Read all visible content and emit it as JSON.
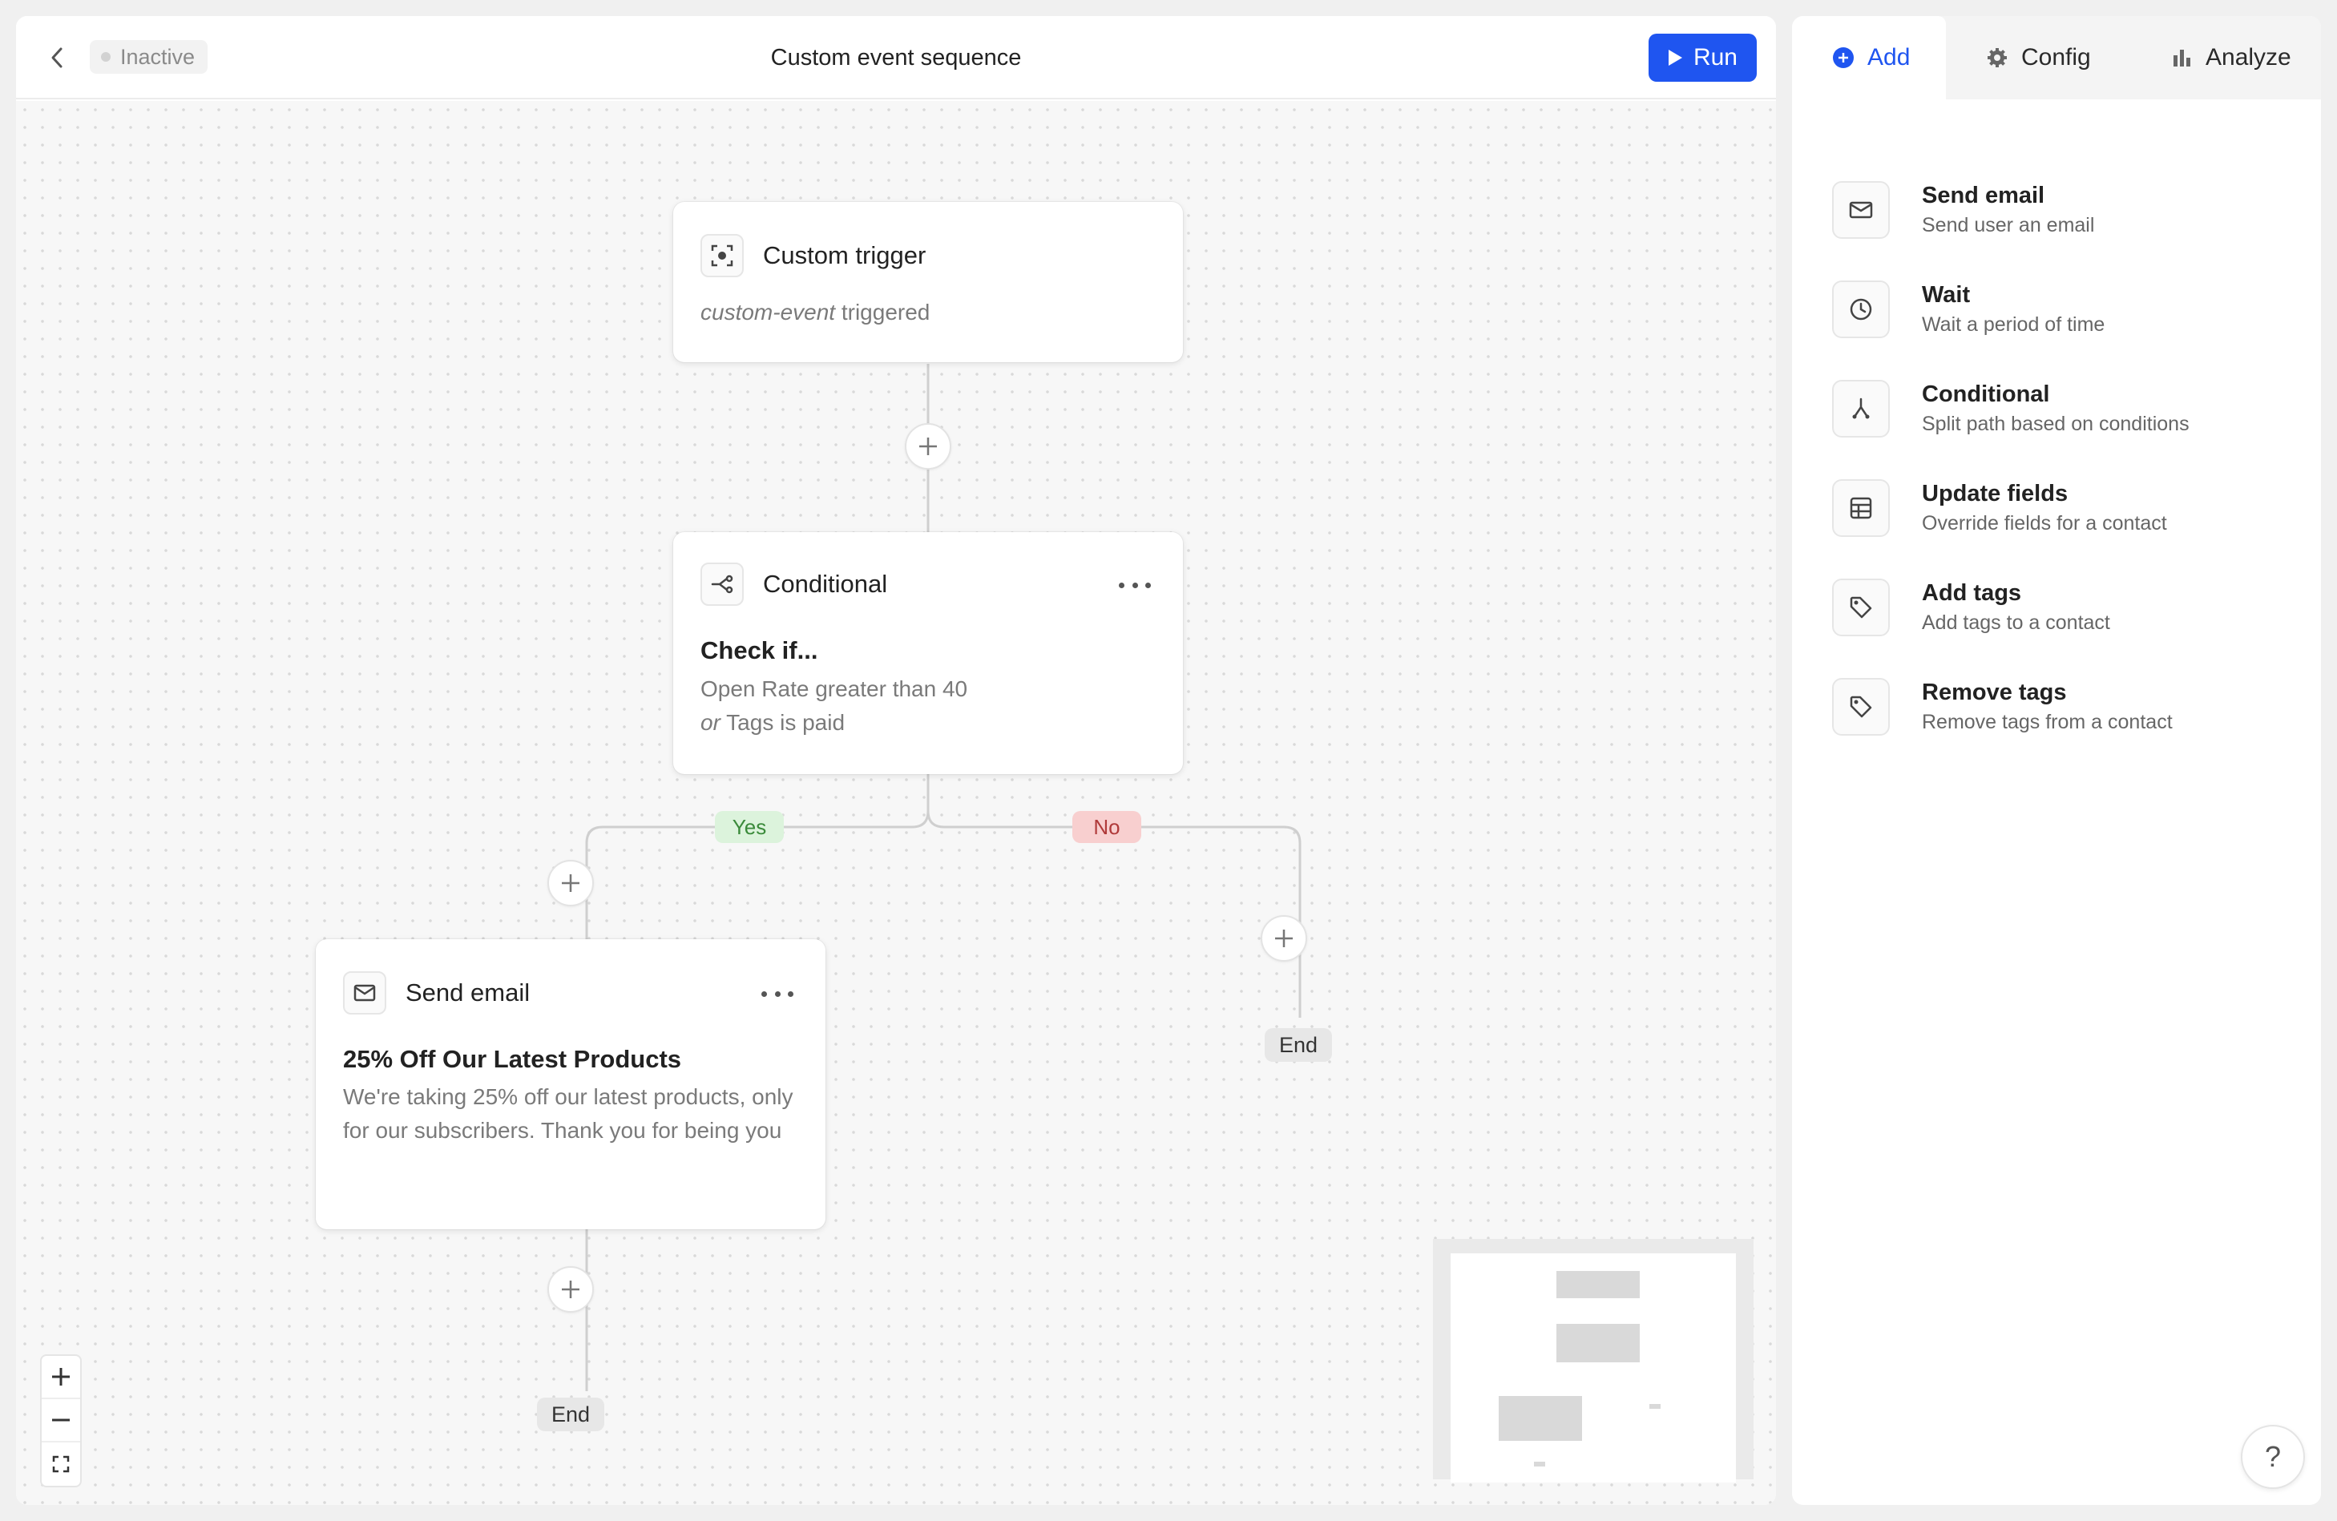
{
  "header": {
    "status": "Inactive",
    "title": "Custom event sequence",
    "run_label": "Run"
  },
  "nodes": {
    "trigger": {
      "title": "Custom trigger",
      "event_name": "custom-event",
      "event_suffix": " triggered"
    },
    "conditional": {
      "title": "Conditional",
      "heading": "Check if...",
      "line1": "Open Rate greater than 40",
      "line2_prefix": "or",
      "line2": " Tags is paid"
    },
    "email": {
      "title": "Send email",
      "subject": "25% Off Our Latest Products",
      "body": "We're taking 25% off our latest products, only for our subscribers. Thank you for being you"
    }
  },
  "branches": {
    "yes": "Yes",
    "no": "No"
  },
  "end_label": "End",
  "tabs": [
    {
      "label": "Add",
      "icon": "plus-circle-icon"
    },
    {
      "label": "Config",
      "icon": "gear-icon"
    },
    {
      "label": "Analyze",
      "icon": "bar-chart-icon"
    }
  ],
  "actions": [
    {
      "title": "Send email",
      "desc": "Send user an email",
      "icon": "mail-icon"
    },
    {
      "title": "Wait",
      "desc": "Wait a period of time",
      "icon": "clock-icon"
    },
    {
      "title": "Conditional",
      "desc": "Split path based on conditions",
      "icon": "split-icon"
    },
    {
      "title": "Update fields",
      "desc": "Override fields for a contact",
      "icon": "table-icon"
    },
    {
      "title": "Add tags",
      "desc": "Add tags to a contact",
      "icon": "tag-icon"
    },
    {
      "title": "Remove tags",
      "desc": "Remove tags from a contact",
      "icon": "tag-icon"
    }
  ],
  "help_label": "?",
  "colors": {
    "accent": "#1f55f0",
    "yes_bg": "#dcf3dc",
    "yes_text": "#3a8a3a",
    "no_bg": "#f8cfcf",
    "no_text": "#b03a3a"
  }
}
